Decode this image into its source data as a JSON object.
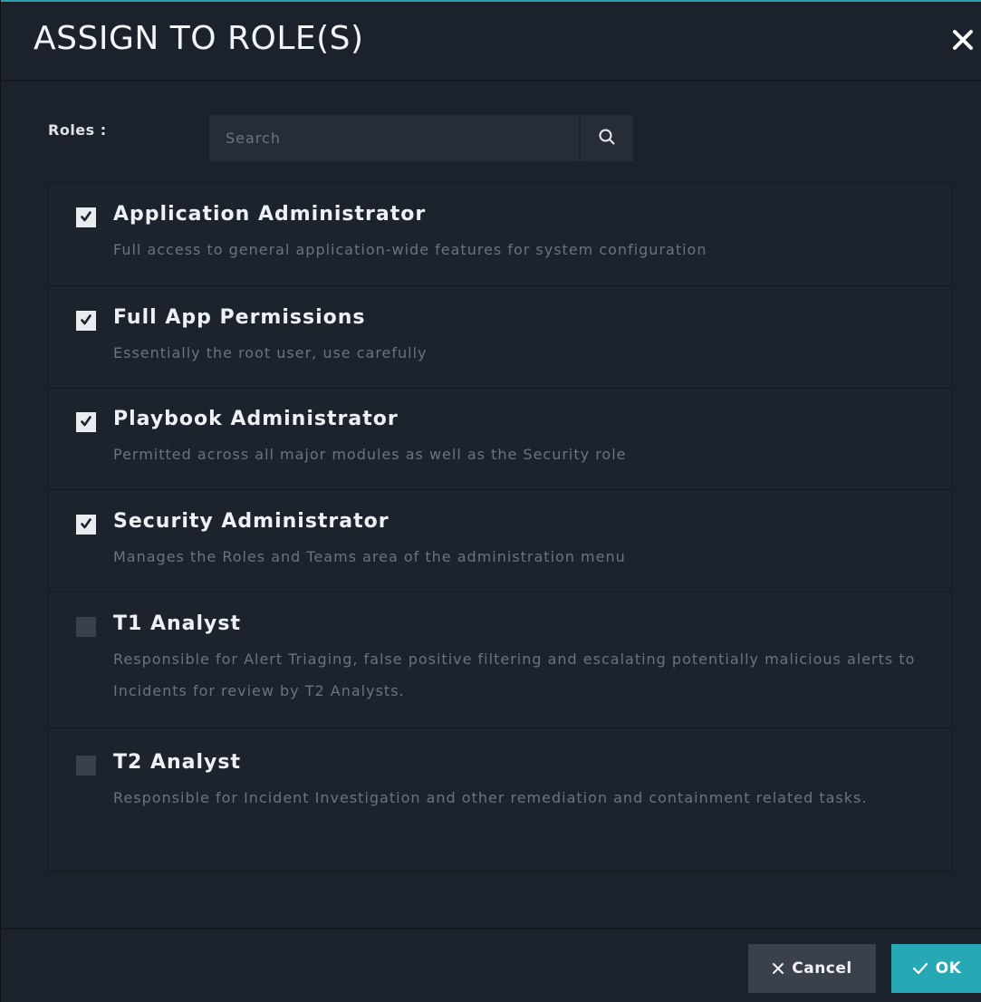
{
  "dialog": {
    "title": "ASSIGN TO ROLE(S)",
    "close_icon": "close-icon"
  },
  "roles_filter": {
    "label": "Roles :",
    "search_placeholder": "Search",
    "search_value": "",
    "search_icon": "search-icon"
  },
  "roles": [
    {
      "name": "Application Administrator",
      "description": "Full access to general application-wide features for system configuration",
      "checked": true
    },
    {
      "name": "Full App Permissions",
      "description": "Essentially the root user, use carefully",
      "checked": true
    },
    {
      "name": "Playbook Administrator",
      "description": "Permitted across all major modules as well as the Security role",
      "checked": true
    },
    {
      "name": "Security Administrator",
      "description": "Manages the Roles and Teams area of the administration menu",
      "checked": true
    },
    {
      "name": "T1 Analyst",
      "description": "Responsible for Alert Triaging, false positive filtering and escalating potentially malicious alerts to Incidents for review by T2 Analysts.",
      "checked": false
    },
    {
      "name": "T2 Analyst",
      "description": "Responsible for Incident Investigation and other remediation and containment related tasks.",
      "checked": false
    }
  ],
  "footer": {
    "cancel_label": "Cancel",
    "ok_label": "OK"
  },
  "colors": {
    "accent": "#27a9b5",
    "background": "#1c222b",
    "checked_box": "#e9ecef",
    "unchecked_box": "#3a414c"
  }
}
